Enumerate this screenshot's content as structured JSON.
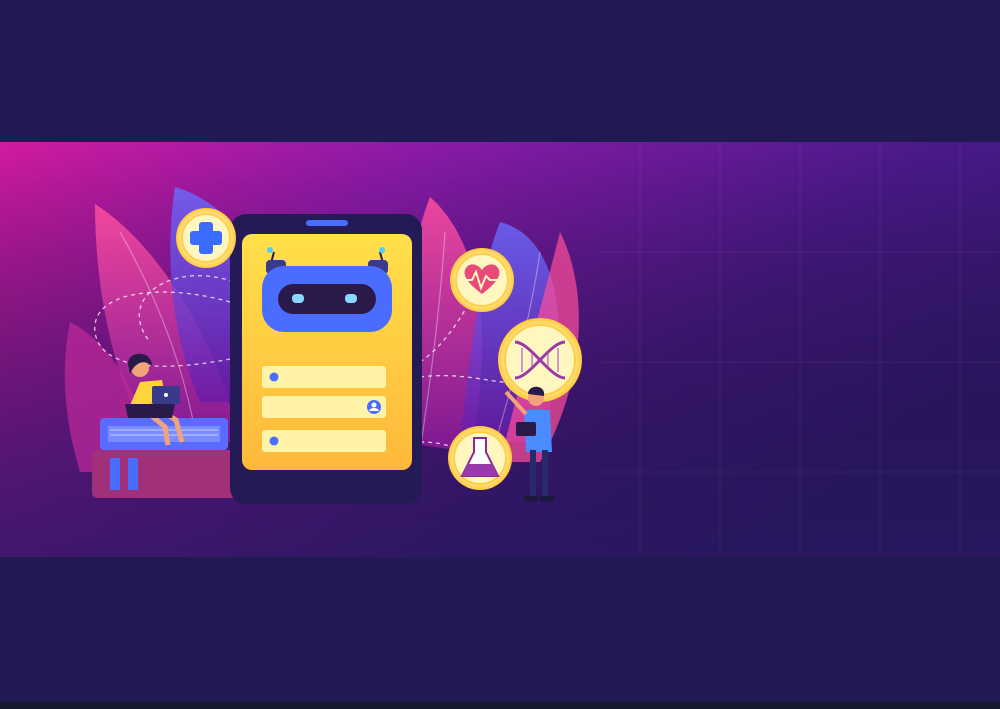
{
  "colors": {
    "background_dark": "#211a52",
    "gradient_left": "#d21aa0",
    "gradient_mid": "#8a1aa8",
    "gradient_right": "#3a1a7a",
    "phone_body": "#241a55",
    "phone_screen": "#ffd33a",
    "accent_blue": "#4a6cff",
    "bubble": "#fff3a8",
    "bottom_edge": "#151b2c"
  },
  "illustration": {
    "subject": "chatbot-healthcare",
    "icons": [
      "medical-cross-icon",
      "heartbeat-icon",
      "dna-icon",
      "flask-icon",
      "robot-icon",
      "user-icon"
    ]
  }
}
